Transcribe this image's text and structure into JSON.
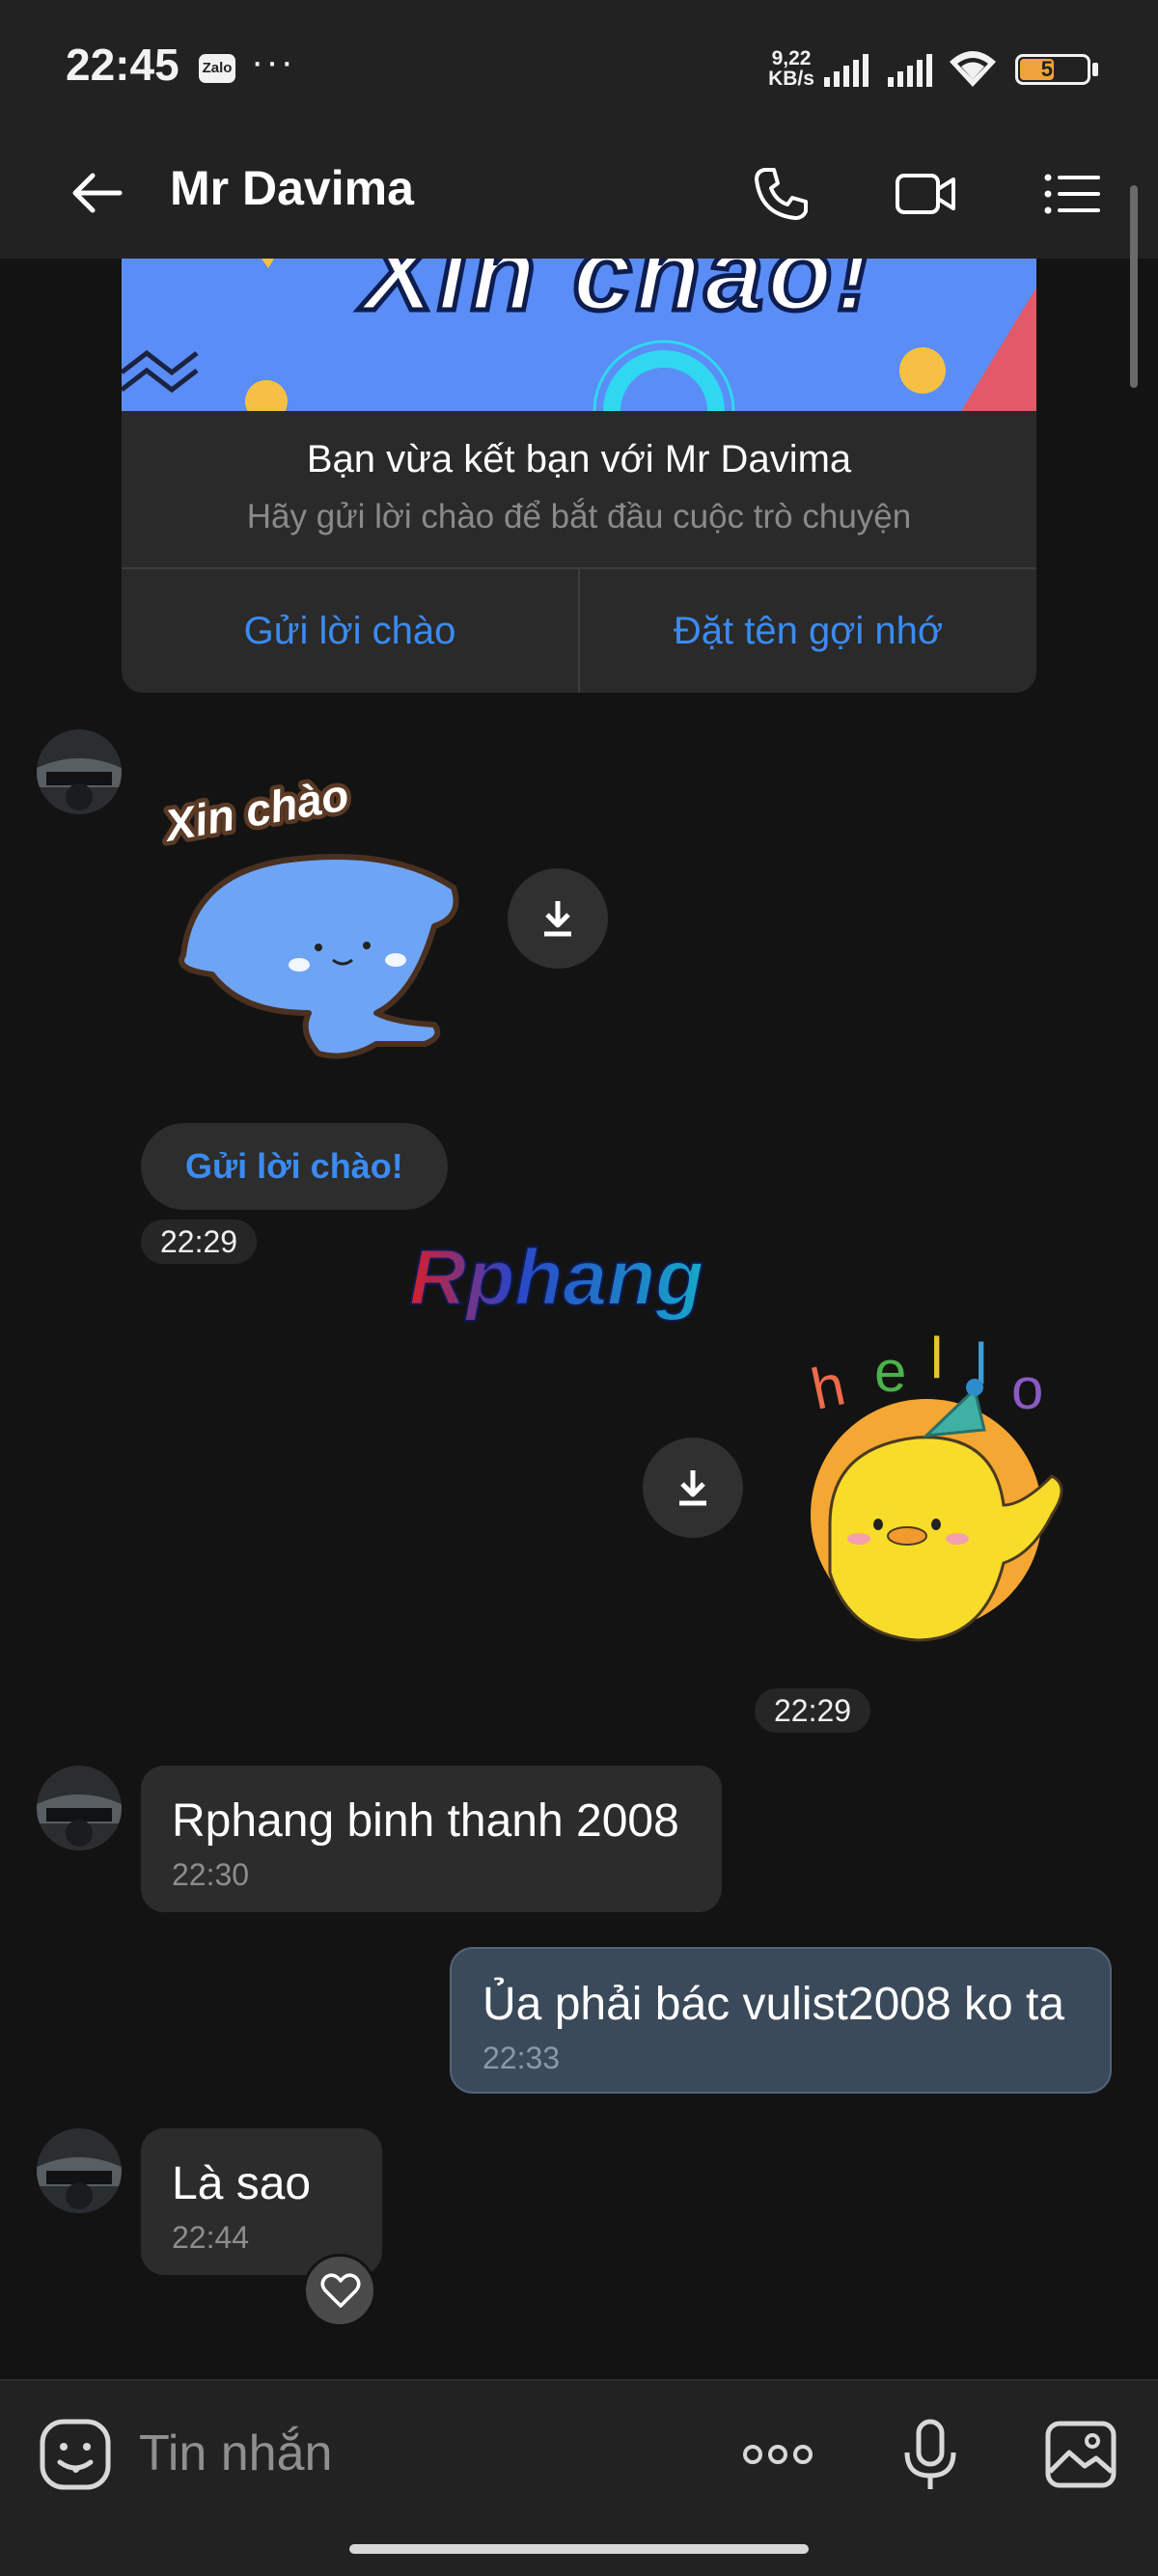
{
  "status_bar": {
    "time": "22:45",
    "app_icon_text": "Zalo",
    "more": "···",
    "net_speed_value": "9,22",
    "net_speed_unit": "KB/s",
    "battery": "51",
    "battery_level": 0.51,
    "battery_color": "#f0a33a"
  },
  "header": {
    "contact_name": "Mr Davima",
    "icons": [
      "back-arrow-icon",
      "phone-icon",
      "video-call-icon",
      "menu-list-icon"
    ]
  },
  "welcome_card": {
    "banner_text": "Xin chào!",
    "title": "Bạn vừa kết bạn với Mr Davima",
    "subtitle": "Hãy gửi lời chào để bắt đầu cuộc trò chuyện",
    "left_button": "Gửi lời chào",
    "right_button": "Đặt tên gợi nhớ"
  },
  "stickers": {
    "incoming_caption": "Xin chào",
    "outgoing_letters": [
      "h",
      "e",
      "l",
      "l",
      "o"
    ]
  },
  "messages": {
    "hello_suggestion": "Gửi lời chào!",
    "sticker_in_time": "22:29",
    "sticker_out_time": "22:29",
    "msg1_text": "Rphang binh thanh 2008",
    "msg1_time": "22:30",
    "msg2_text": "Ủa phải bác vulist2008 ko ta",
    "msg2_time": "22:33",
    "msg3_text": "Là sao",
    "msg3_time": "22:44"
  },
  "watermark": "Rphang",
  "composer": {
    "placeholder": "Tin nhắn"
  },
  "colors": {
    "accent_blue": "#3b8bf2",
    "background": "#131313",
    "bar": "#222222",
    "incoming_bubble": "#2c2c2c",
    "outgoing_bubble": "#3b4a5a"
  }
}
